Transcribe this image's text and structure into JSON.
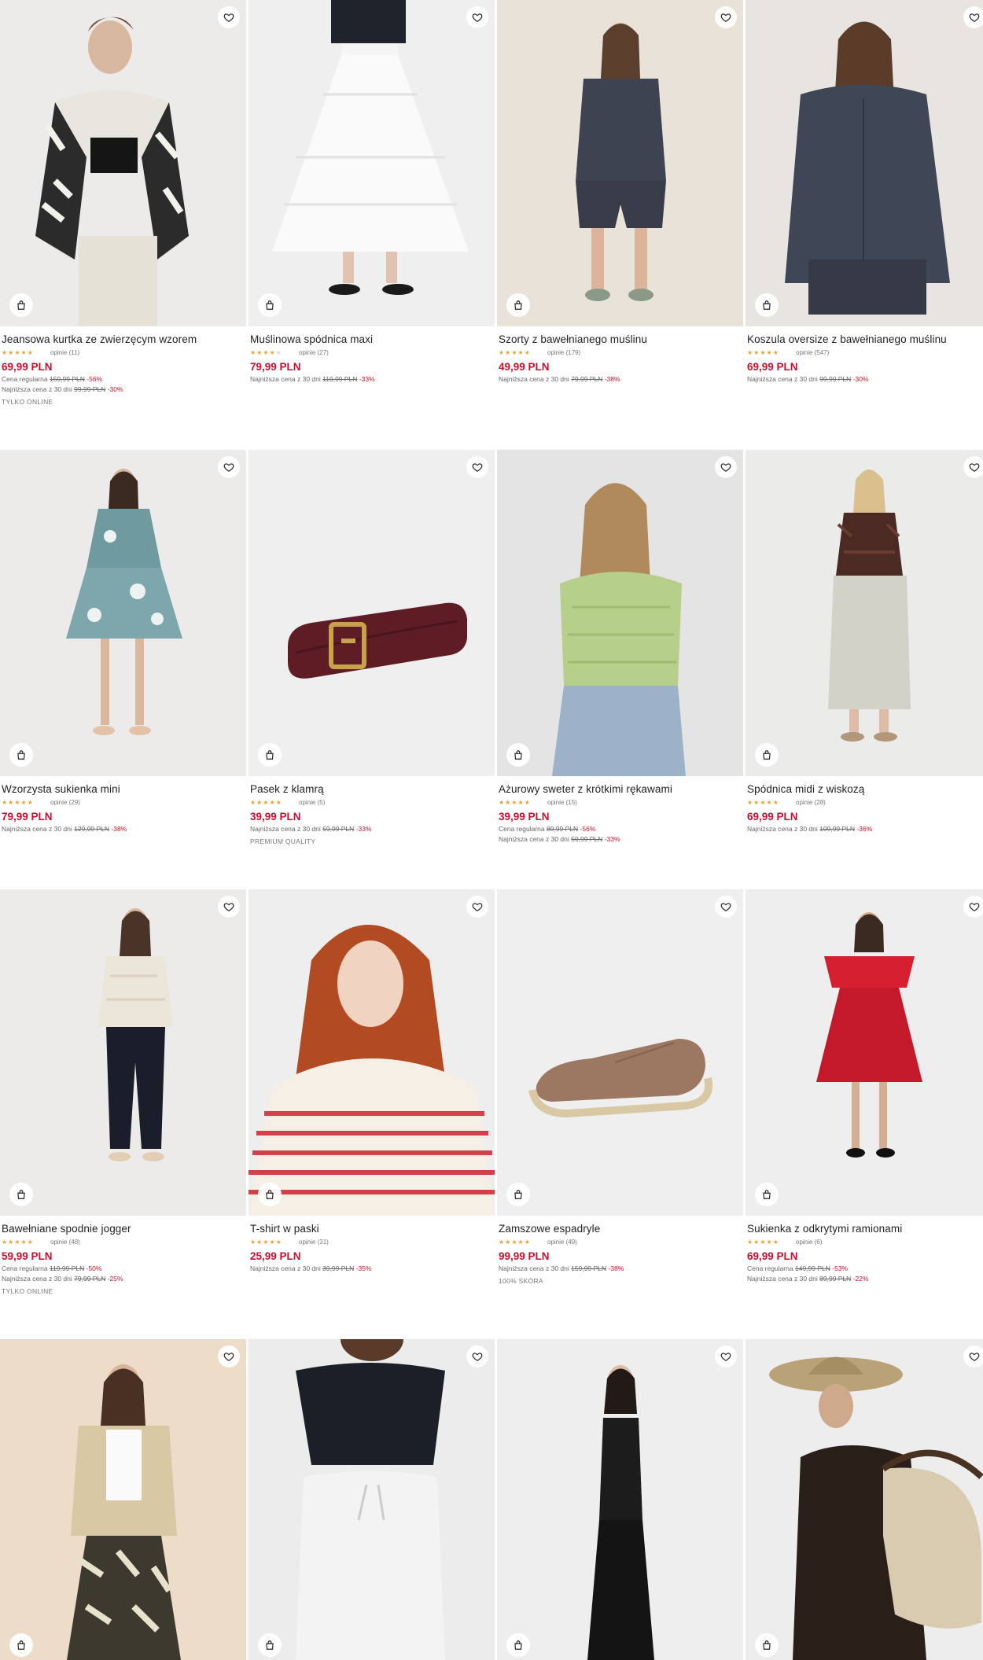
{
  "colors": {
    "accent_price": "#c8102e",
    "star": "#e8a23c"
  },
  "icons": {
    "favorite": "heart-icon",
    "cart": "shopping-bag-icon"
  },
  "products": [
    {
      "name": "Jeansowa kurtka ze zwierzęcym wzorem",
      "rating": 5,
      "reviews": "opinie (11)",
      "price": "69,99 PLN",
      "lines": [
        {
          "label": "Cena regularna",
          "old": "159,99 PLN",
          "disc": "-56%"
        },
        {
          "label": "Najniższa cena z 30 dni",
          "old": "99,99 PLN",
          "disc": "-30%"
        }
      ],
      "tag": "TYLKO ONLINE"
    },
    {
      "name": "Muślinowa spódnica maxi",
      "rating": 4,
      "reviews": "opinie (27)",
      "price": "79,99 PLN",
      "lines": [
        {
          "label": "Najniższa cena z 30 dni",
          "old": "119,99 PLN",
          "disc": "-33%"
        }
      ],
      "tag": ""
    },
    {
      "name": "Szorty z bawełnianego muślinu",
      "rating": 4.5,
      "reviews": "opinie (179)",
      "price": "49,99 PLN",
      "lines": [
        {
          "label": "Najniższa cena z 30 dni",
          "old": "79,99 PLN",
          "disc": "-38%"
        }
      ],
      "tag": ""
    },
    {
      "name": "Koszula oversize z bawełnianego muślinu",
      "rating": 4.5,
      "reviews": "opinie (547)",
      "price": "69,99 PLN",
      "lines": [
        {
          "label": "Najniższa cena z 30 dni",
          "old": "99,99 PLN",
          "disc": "-30%"
        }
      ],
      "tag": ""
    },
    {
      "name": "Wzorzysta sukienka mini",
      "rating": 5,
      "reviews": "opinie (29)",
      "price": "79,99 PLN",
      "lines": [
        {
          "label": "Najniższa cena z 30 dni",
          "old": "129,99 PLN",
          "disc": "-38%"
        }
      ],
      "tag": ""
    },
    {
      "name": "Pasek z klamrą",
      "rating": 5,
      "reviews": "opinie (5)",
      "price": "39,99 PLN",
      "lines": [
        {
          "label": "Najniższa cena z 30 dni",
          "old": "59,99 PLN",
          "disc": "-33%"
        }
      ],
      "tag": "PREMIUM QUALITY"
    },
    {
      "name": "Ażurowy sweter z krótkimi rękawami",
      "rating": 5,
      "reviews": "opinie (15)",
      "price": "39,99 PLN",
      "lines": [
        {
          "label": "Cena regularna",
          "old": "89,99 PLN",
          "disc": "-56%"
        },
        {
          "label": "Najniższa cena z 30 dni",
          "old": "59,99 PLN",
          "disc": "-33%"
        }
      ],
      "tag": ""
    },
    {
      "name": "Spódnica midi z wiskozą",
      "rating": 5,
      "reviews": "opinie (28)",
      "price": "69,99 PLN",
      "lines": [
        {
          "label": "Najniższa cena z 30 dni",
          "old": "109,99 PLN",
          "disc": "-36%"
        }
      ],
      "tag": ""
    },
    {
      "name": "Bawełniane spodnie jogger",
      "rating": 4.5,
      "reviews": "opinie (48)",
      "price": "59,99 PLN",
      "lines": [
        {
          "label": "Cena regularna",
          "old": "119,99 PLN",
          "disc": "-50%"
        },
        {
          "label": "Najniższa cena z 30 dni",
          "old": "79,99 PLN",
          "disc": "-25%"
        }
      ],
      "tag": "TYLKO ONLINE"
    },
    {
      "name": "T-shirt w paski",
      "rating": 5,
      "reviews": "opinie (31)",
      "price": "25,99 PLN",
      "lines": [
        {
          "label": "Najniższa cena z 30 dni",
          "old": "39,99 PLN",
          "disc": "-35%"
        }
      ],
      "tag": ""
    },
    {
      "name": "Zamszowe espadryle",
      "rating": 4.5,
      "reviews": "opinie (49)",
      "price": "99,99 PLN",
      "lines": [
        {
          "label": "Najniższa cena z 30 dni",
          "old": "159,99 PLN",
          "disc": "-38%"
        }
      ],
      "tag": "100% SKÓRA"
    },
    {
      "name": "Sukienka z odkrytymi ramionami",
      "rating": 5,
      "reviews": "opinie (6)",
      "price": "69,99 PLN",
      "lines": [
        {
          "label": "Cena regularna",
          "old": "149,99 PLN",
          "disc": "-53%"
        },
        {
          "label": "Najniższa cena z 30 dni",
          "old": "89,99 PLN",
          "disc": "-22%"
        }
      ],
      "tag": ""
    },
    {
      "name": "",
      "rating": 0,
      "reviews": "",
      "price": "",
      "lines": [],
      "tag": ""
    },
    {
      "name": "",
      "rating": 0,
      "reviews": "",
      "price": "",
      "lines": [],
      "tag": ""
    },
    {
      "name": "",
      "rating": 0,
      "reviews": "",
      "price": "",
      "lines": [],
      "tag": ""
    },
    {
      "name": "",
      "rating": 0,
      "reviews": "",
      "price": "",
      "lines": [],
      "tag": ""
    }
  ]
}
